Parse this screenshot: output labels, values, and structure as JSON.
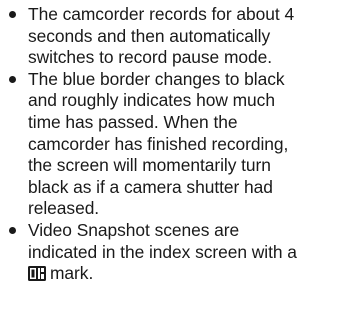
{
  "bullets": [
    {
      "lines": [
        "The camcorder records for about 4",
        "seconds and then automatically",
        "switches to record pause mode."
      ]
    },
    {
      "lines": [
        "The blue border changes to black",
        "and roughly indicates how much",
        "time has passed. When the",
        "camcorder has finished recording,",
        "the screen will momentarily turn",
        "black as if a camera shutter had",
        "released."
      ]
    },
    {
      "lines": [
        "Video Snapshot scenes are",
        "indicated in the index screen with a"
      ],
      "icon_name": "video-snapshot-icon",
      "after_icon": "mark."
    }
  ]
}
